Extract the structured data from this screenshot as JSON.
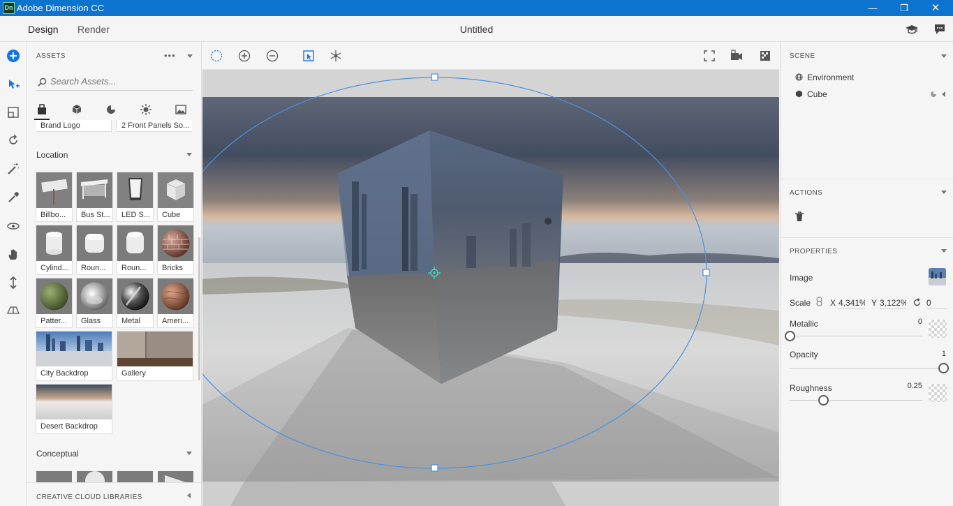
{
  "app": {
    "title": "Adobe Dimension CC",
    "logo_text": "Dn"
  },
  "menu": {
    "tabs": [
      {
        "label": "Design",
        "active": true
      },
      {
        "label": "Render",
        "active": false
      }
    ],
    "document_title": "Untitled"
  },
  "assets": {
    "header": "ASSETS",
    "search_placeholder": "Search Assets...",
    "partial_row": [
      "Brand Logo",
      "2 Front Panels So..."
    ],
    "sections": [
      {
        "title": "Location",
        "items": [
          "Billbo...",
          "Bus St...",
          "LED S...",
          "Cube",
          "Cylind...",
          "Roun...",
          "Roun...",
          "Bricks",
          "Patter...",
          "Glass",
          "Metal",
          "Ameri..."
        ],
        "wide_items": [
          "City Backdrop",
          "Gallery",
          "Desert Backdrop"
        ]
      },
      {
        "title": "Conceptual"
      }
    ],
    "libraries_header": "CREATIVE CLOUD LIBRARIES"
  },
  "scene": {
    "header": "SCENE",
    "items": [
      "Environment",
      "Cube"
    ]
  },
  "actions": {
    "header": "ACTIONS"
  },
  "properties": {
    "header": "PROPERTIES",
    "image_label": "Image",
    "scale": {
      "label": "Scale",
      "x_label": "X",
      "x_value": "4,341%",
      "y_label": "Y",
      "y_value": "3,122%",
      "rotation": "0"
    },
    "metallic": {
      "label": "Metallic",
      "value": "0",
      "level": 0
    },
    "opacity": {
      "label": "Opacity",
      "value": "1",
      "level": 1
    },
    "roughness": {
      "label": "Roughness",
      "value": "0.25",
      "level": 0.25
    }
  },
  "colors": {
    "titlebar": "#0c73cf",
    "accent": "#1473e6",
    "selection": "#4a90e2"
  }
}
